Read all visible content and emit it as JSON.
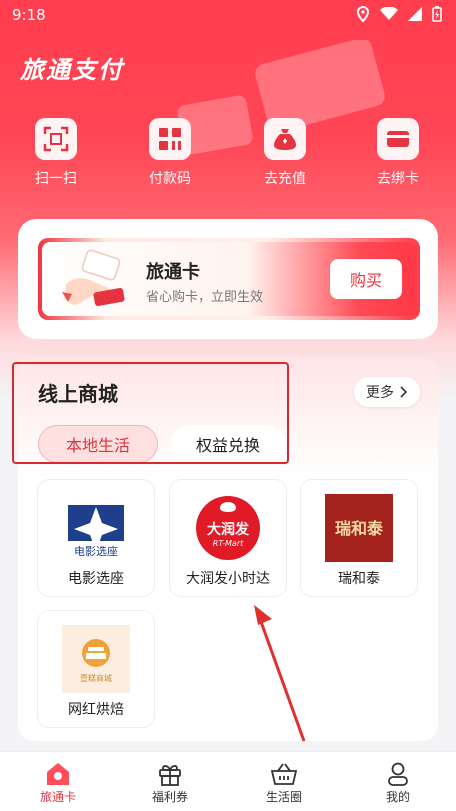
{
  "status_bar": {
    "time": "9:18"
  },
  "app": {
    "title": "旅通支付"
  },
  "quick_actions": [
    {
      "label": "扫一扫",
      "icon": "scan-icon"
    },
    {
      "label": "付款码",
      "icon": "qr-code-icon"
    },
    {
      "label": "去充值",
      "icon": "money-bag-icon"
    },
    {
      "label": "去绑卡",
      "icon": "card-icon"
    }
  ],
  "travel_card": {
    "title": "旅通卡",
    "subtitle": "省心购卡，立即生效",
    "buy_label": "购买"
  },
  "mall": {
    "title": "线上商城",
    "more_label": "更多",
    "tabs": [
      {
        "label": "本地生活",
        "active": true
      },
      {
        "label": "权益兑换",
        "active": false
      }
    ],
    "items": [
      {
        "label": "电影选座",
        "logo_text": "电影选座"
      },
      {
        "label": "大润发小时达",
        "logo_text": "大润发",
        "logo_sub": "RT-Mart"
      },
      {
        "label": "瑞和泰",
        "logo_text": "瑞和泰"
      },
      {
        "label": "网红烘焙",
        "logo_text": "壹糕商城"
      }
    ]
  },
  "bottom_nav": [
    {
      "label": "旅通卡",
      "icon": "home-icon",
      "active": true
    },
    {
      "label": "福利券",
      "icon": "gift-icon",
      "active": false
    },
    {
      "label": "生活圈",
      "icon": "basket-icon",
      "active": false
    },
    {
      "label": "我的",
      "icon": "person-icon",
      "active": false
    }
  ],
  "colors": {
    "primary": "#ff3d4e",
    "accent_text": "#e53442",
    "highlight_border": "#d9282e"
  }
}
